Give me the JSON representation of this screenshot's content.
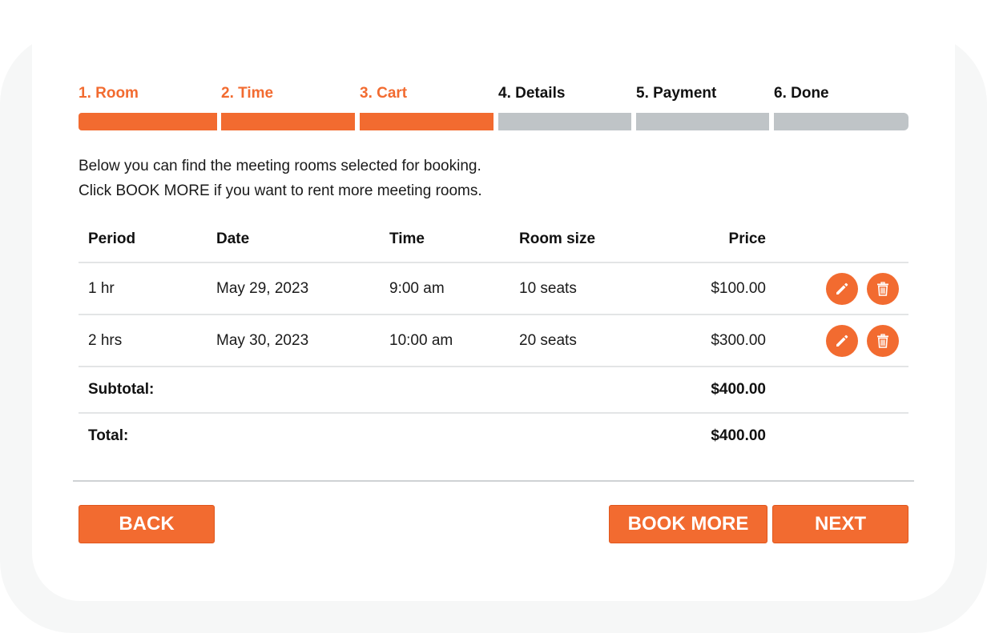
{
  "steps": [
    {
      "label": "1. Room",
      "active": true
    },
    {
      "label": "2. Time",
      "active": true
    },
    {
      "label": "3. Cart",
      "active": true
    },
    {
      "label": "4. Details",
      "active": false
    },
    {
      "label": "5. Payment",
      "active": false
    },
    {
      "label": "6. Done",
      "active": false
    }
  ],
  "intro": {
    "line1": "Below you can find the meeting rooms selected for booking.",
    "line2": "Click BOOK MORE if you want to rent more meeting rooms."
  },
  "table": {
    "headers": {
      "period": "Period",
      "date": "Date",
      "time": "Time",
      "room_size": "Room size",
      "price": "Price"
    },
    "rows": [
      {
        "period": "1 hr",
        "date": "May 29, 2023",
        "time": "9:00 am",
        "room_size": "10 seats",
        "price": "$100.00"
      },
      {
        "period": "2 hrs",
        "date": "May 30, 2023",
        "time": "10:00 am",
        "room_size": "20 seats",
        "price": "$300.00"
      }
    ],
    "subtotal_label": "Subtotal:",
    "subtotal_value": "$400.00",
    "total_label": "Total:",
    "total_value": "$400.00"
  },
  "buttons": {
    "back": "BACK",
    "book_more": "BOOK MORE",
    "next": "NEXT"
  },
  "colors": {
    "accent": "#f26b30",
    "inactive_step": "#bfc4c7"
  },
  "icons": {
    "edit": "pencil-icon",
    "delete": "trash-icon"
  }
}
